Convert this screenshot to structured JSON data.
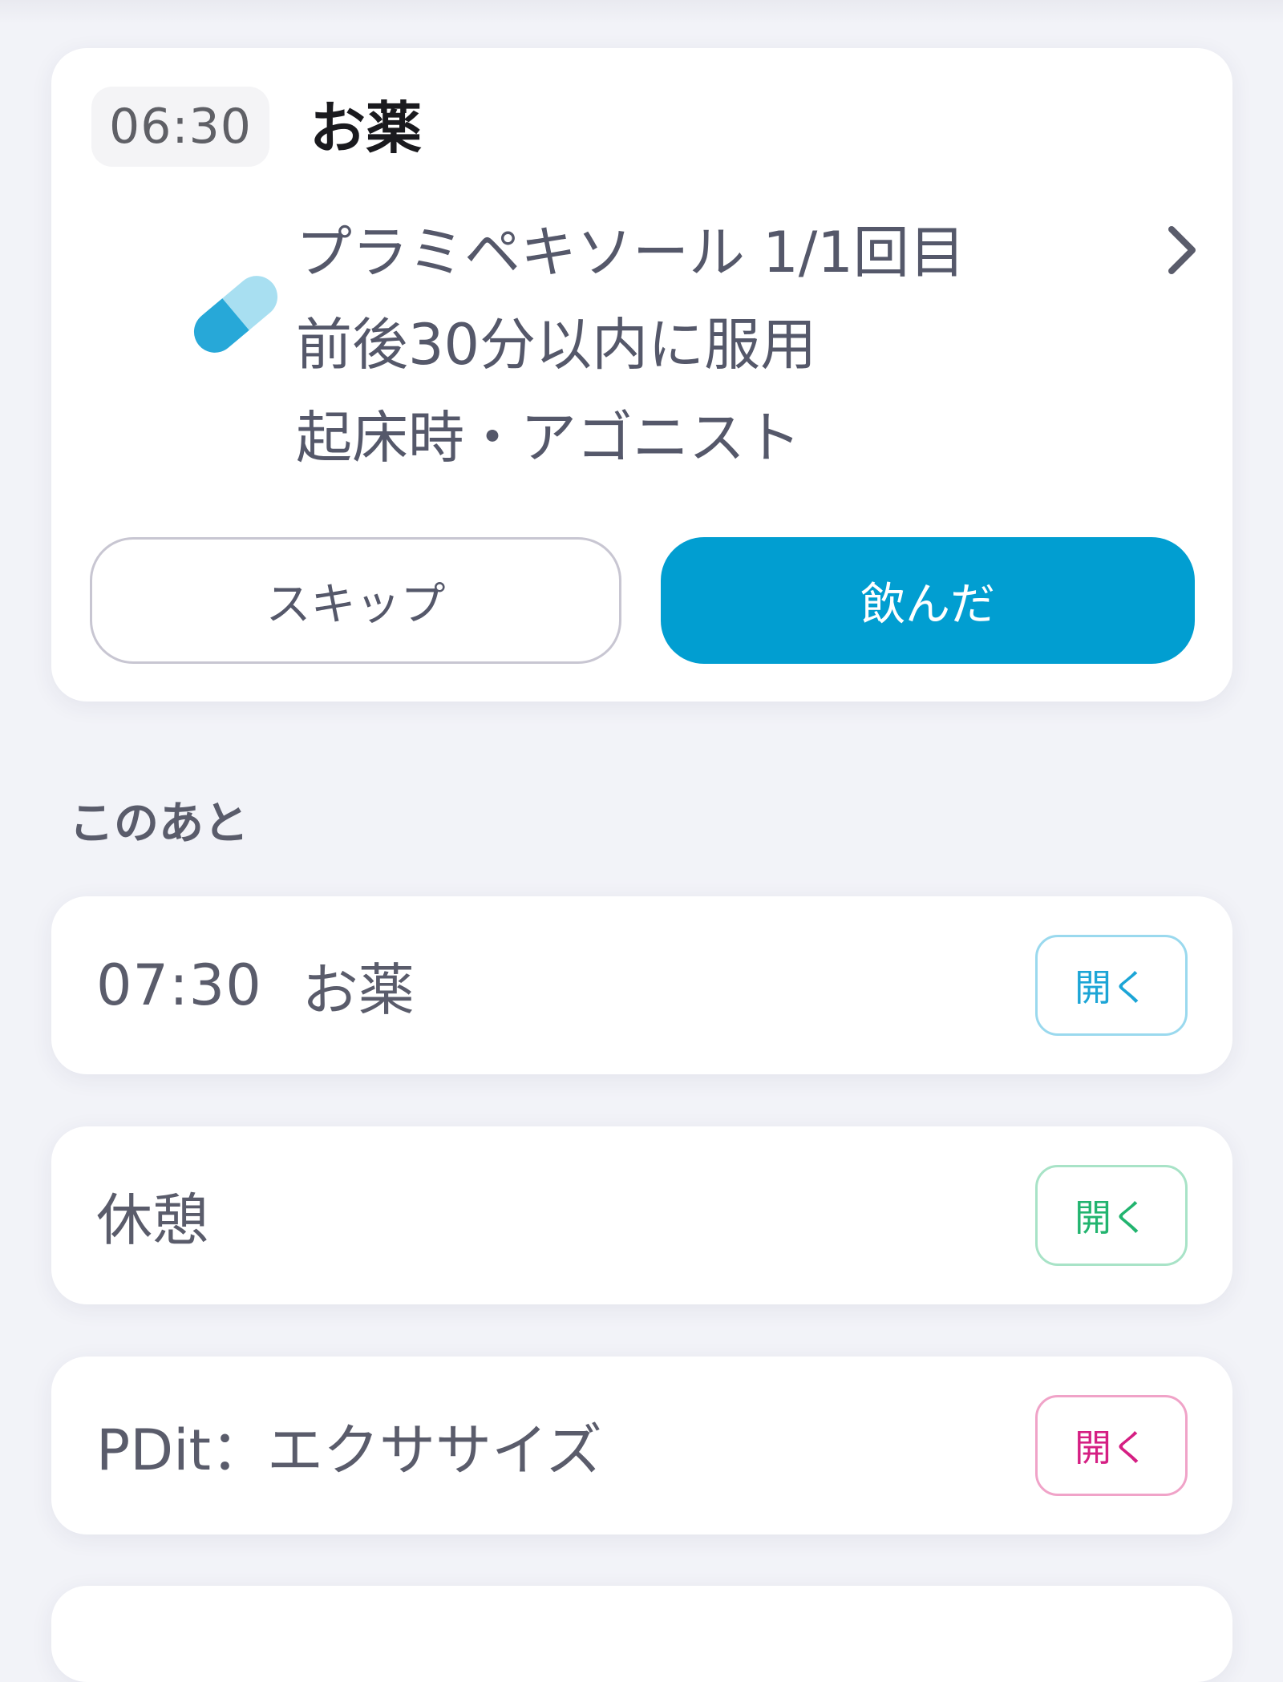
{
  "current": {
    "time": "06:30",
    "title": "お薬",
    "medicine_name": "プラミペキソール 1/1回目",
    "timing_note": "前後30分以内に服用",
    "tags": "起床時・アゴニスト",
    "skip_label": "スキップ",
    "taken_label": "飲んだ",
    "icon": "capsule-icon",
    "accent_color": "#019ed1"
  },
  "upcoming": {
    "heading": "このあと",
    "items": [
      {
        "time": "07:30",
        "label": "お薬",
        "open_label": "開く",
        "color": "#1ca5d6"
      },
      {
        "time": "",
        "label": "休憩",
        "open_label": "開く",
        "color": "#22b46f"
      },
      {
        "time": "",
        "label": "PDit：エクササイズ",
        "open_label": "開く",
        "color": "#d51f83"
      }
    ]
  }
}
